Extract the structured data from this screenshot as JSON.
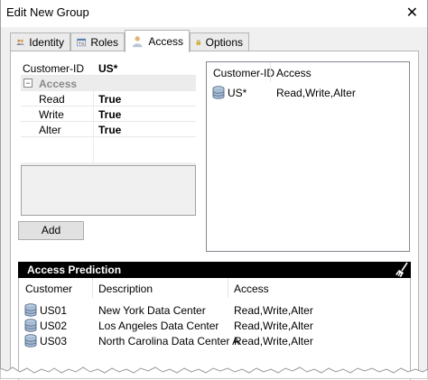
{
  "window": {
    "title": "Edit New Group",
    "close_glyph": "✕"
  },
  "tabs": [
    {
      "label": "Identity",
      "icon": "users-icon",
      "active": false
    },
    {
      "label": "Roles",
      "icon": "roles-icon",
      "active": false
    },
    {
      "label": "Access",
      "icon": "person-icon",
      "active": true
    },
    {
      "label": "Options",
      "icon": "lock-icon",
      "active": false
    }
  ],
  "properties": {
    "customer_id_label": "Customer-ID",
    "customer_id_value": "US*",
    "category_label": "Access",
    "category_toggle": "−",
    "rows": [
      {
        "label": "Read",
        "value": "True"
      },
      {
        "label": "Write",
        "value": "True"
      },
      {
        "label": "Alter",
        "value": "True"
      }
    ]
  },
  "add_button": "Add",
  "access_list": {
    "columns": [
      "Customer-ID",
      "Access"
    ],
    "rows": [
      {
        "customer": "US*",
        "access": "Read,Write,Alter"
      }
    ]
  },
  "prediction": {
    "title": "Access Prediction",
    "columns": [
      "Customer",
      "Description",
      "Access"
    ],
    "rows": [
      {
        "customer": "US01",
        "description": "New York Data Center",
        "access": "Read,Write,Alter"
      },
      {
        "customer": "US02",
        "description": "Los Angeles Data Center",
        "access": "Read,Write,Alter"
      },
      {
        "customer": "US03",
        "description": "North Carolina Data Center A",
        "access": "Read,Write,Alter"
      }
    ]
  }
}
